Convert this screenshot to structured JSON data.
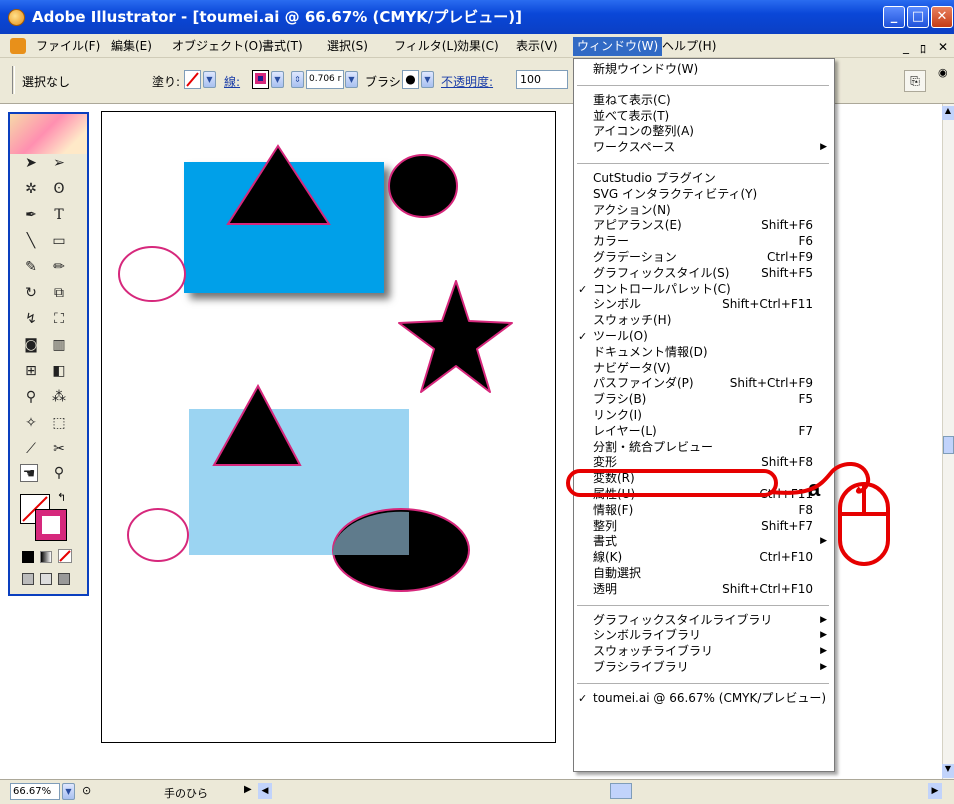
{
  "title": "Adobe Illustrator - [toumei.ai @ 66.67% (CMYK/プレビュー)]",
  "window_controls": {
    "minimize": "_",
    "restore": "□",
    "close": "✕"
  },
  "menubar": [
    "ファイル(F)",
    "編集(E)",
    "オブジェクト(O)",
    "書式(T)",
    "選択(S)",
    "フィルタ(L)",
    "効果(C)",
    "表示(V)",
    "ウィンドウ(W)",
    "ヘルプ(H)"
  ],
  "menubar_right": {
    "min": "_",
    "restore": "ﾛ",
    "close": "✕"
  },
  "control": {
    "selection": "選択なし",
    "fill_label": "塗り:",
    "stroke_label": "線:",
    "stroke_weight": "0.706 r",
    "brush_label": "ブラシ:",
    "opacity_label": "不透明度:",
    "opacity_value": "100"
  },
  "window_menu": {
    "items": [
      {
        "label": "新規ウインドウ(W)"
      },
      {
        "sep": true
      },
      {
        "label": "重ねて表示(C)"
      },
      {
        "label": "並べて表示(T)"
      },
      {
        "label": "アイコンの整列(A)"
      },
      {
        "label": "ワークスペース",
        "submenu": true
      },
      {
        "sep": true
      },
      {
        "label": "CutStudio プラグイン"
      },
      {
        "label": "SVG インタラクティビティ(Y)"
      },
      {
        "label": "アクション(N)"
      },
      {
        "label": "アピアランス(E)",
        "shortcut": "Shift+F6"
      },
      {
        "label": "カラー",
        "shortcut": "F6"
      },
      {
        "label": "グラデーション",
        "shortcut": "Ctrl+F9"
      },
      {
        "label": "グラフィックスタイル(S)",
        "shortcut": "Shift+F5"
      },
      {
        "label": "コントロールパレット(C)",
        "checked": true
      },
      {
        "label": "シンボル",
        "shortcut": "Shift+Ctrl+F11"
      },
      {
        "label": "スウォッチ(H)"
      },
      {
        "label": "ツール(O)",
        "checked": true
      },
      {
        "label": "ドキュメント情報(D)"
      },
      {
        "label": "ナビゲータ(V)"
      },
      {
        "label": "パスファインダ(P)",
        "shortcut": "Shift+Ctrl+F9"
      },
      {
        "label": "ブラシ(B)",
        "shortcut": "F5"
      },
      {
        "label": "リンク(I)"
      },
      {
        "label": "レイヤー(L)",
        "shortcut": "F7"
      },
      {
        "label": "分割・統合プレビュー",
        "highlighted": true
      },
      {
        "label": "変形",
        "shortcut": "Shift+F8"
      },
      {
        "label": "変数(R)"
      },
      {
        "label": "属性(U)",
        "shortcut": "Ctrl+F11"
      },
      {
        "label": "情報(F)",
        "shortcut": "F8"
      },
      {
        "label": "整列",
        "shortcut": "Shift+F7"
      },
      {
        "label": "書式",
        "submenu": true
      },
      {
        "label": "線(K)",
        "shortcut": "Ctrl+F10"
      },
      {
        "label": "自動選択"
      },
      {
        "label": "透明",
        "shortcut": "Shift+Ctrl+F10"
      },
      {
        "sep": true
      },
      {
        "label": "グラフィックスタイルライブラリ",
        "submenu": true
      },
      {
        "label": "シンボルライブラリ",
        "submenu": true
      },
      {
        "label": "スウォッチライブラリ",
        "submenu": true
      },
      {
        "label": "ブラシライブラリ",
        "submenu": true
      },
      {
        "sep": true
      },
      {
        "label": "toumei.ai @ 66.67% (CMYK/プレビュー)",
        "checked": true
      }
    ]
  },
  "status": {
    "zoom": "66.67%",
    "tool": "手のひら"
  },
  "annotation_text": "a",
  "colors": {
    "accent": "#316ac5",
    "highlight": "#e60000",
    "stroke_magenta": "#d6287c",
    "blue_fill": "#00a0e9",
    "light_blue_fill": "#9bd4f2"
  }
}
